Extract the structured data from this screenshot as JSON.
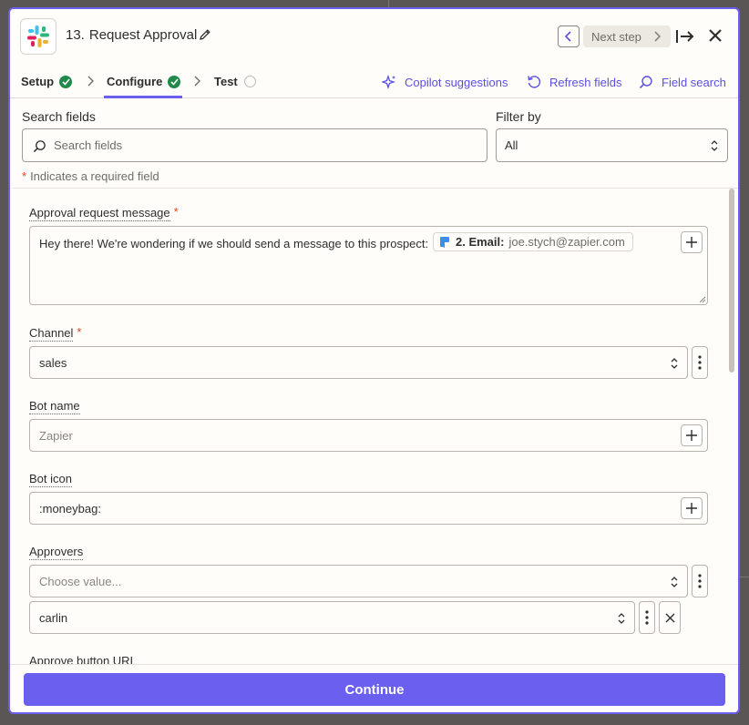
{
  "colors": {
    "accent": "#6b5ff0",
    "success": "#1f8a4c",
    "required": "#e1401b",
    "panel_background": "#fffdf9"
  },
  "header": {
    "app_icon": "slack-logo-icon",
    "step_number": "13.",
    "title": "Request Approval",
    "next_step_label": "Next step"
  },
  "tabs": [
    {
      "label": "Setup",
      "status": "complete"
    },
    {
      "label": "Configure",
      "status": "complete",
      "active": true
    },
    {
      "label": "Test",
      "status": "pending"
    }
  ],
  "actions": {
    "copilot": "Copilot suggestions",
    "refresh": "Refresh fields",
    "field_search": "Field search"
  },
  "search": {
    "label": "Search fields",
    "placeholder": "Search fields",
    "filter_label": "Filter by",
    "filter_value": "All"
  },
  "required_note": {
    "star": "*",
    "text": "Indicates a required field"
  },
  "fields": {
    "approval_message": {
      "label": "Approval request message",
      "required_mark": "*",
      "text": "Hey there! We're wondering if we should send a message to this prospect:",
      "pill_label": "2. Email:",
      "pill_value": "joe.stych@zapier.com"
    },
    "channel": {
      "label": "Channel",
      "required_mark": "*",
      "value": "sales"
    },
    "bot_name": {
      "label": "Bot name",
      "placeholder": "Zapier"
    },
    "bot_icon": {
      "label": "Bot icon",
      "value": ":moneybag:"
    },
    "approvers": {
      "label": "Approvers",
      "placeholder": "Choose value...",
      "selected": "carlin"
    },
    "approve_button_url": {
      "label": "Approve button URL"
    }
  },
  "footer": {
    "continue_label": "Continue"
  }
}
